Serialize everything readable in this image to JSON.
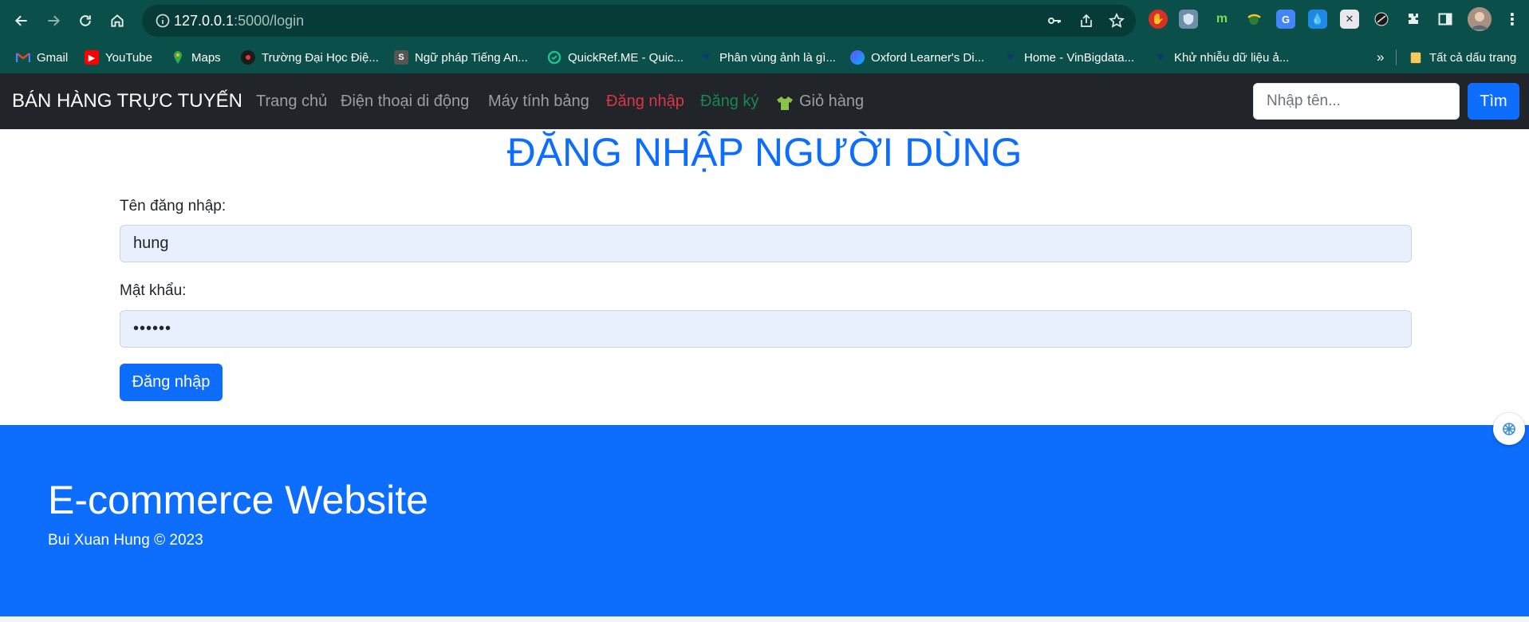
{
  "browser": {
    "url_host": "127.0.0.1",
    "url_path": ":5000/login",
    "bookmarks": [
      {
        "label": "Gmail",
        "icon": "gmail-icon",
        "color": "#ea4335"
      },
      {
        "label": "YouTube",
        "icon": "youtube-icon",
        "color": "#ff0000"
      },
      {
        "label": "Maps",
        "icon": "maps-icon",
        "color": "#34a853"
      },
      {
        "label": "Trường Đại Học Điệ...",
        "icon": "university-icon",
        "color": "#c62828"
      },
      {
        "label": "Ngữ pháp Tiếng An...",
        "icon": "s-icon",
        "color": "#444444"
      },
      {
        "label": "QuickRef.ME - Quic...",
        "icon": "quickref-icon",
        "color": "#1fbf8f"
      },
      {
        "label": "Phân vùng ảnh là gì...",
        "icon": "heart-icon",
        "color": "#0b3b6f"
      },
      {
        "label": "Oxford Learner's Di...",
        "icon": "oxford-icon",
        "color": "#6a4cff"
      },
      {
        "label": "Home - VinBigdata...",
        "icon": "heart-icon",
        "color": "#0b3b6f"
      },
      {
        "label": "Khử nhiễu dữ liệu ả...",
        "icon": "heart-icon",
        "color": "#0b3b6f"
      }
    ],
    "overflow": "»",
    "all_bookmarks": "Tất cả dấu trang"
  },
  "navbar": {
    "brand": "BÁN HÀNG TRỰC TUYẾN",
    "links": [
      "Trang chủ",
      "Điện thoại di động",
      "Máy tính bảng",
      "Đăng nhập",
      "Đăng ký",
      "Giỏ hàng"
    ],
    "search_placeholder": "Nhập tên...",
    "search_button": "Tìm"
  },
  "form": {
    "title": "ĐĂNG NHẬP NGƯỜI DÙNG",
    "username_label": "Tên đăng nhập:",
    "username_value": "hung",
    "password_label": "Mật khẩu:",
    "password_value": "••••••",
    "submit": "Đăng nhập"
  },
  "footer": {
    "title": "E-commerce Website",
    "copyright": "Bui Xuan Hung © 2023"
  },
  "colors": {
    "chrome": "#0b4f4a",
    "navbar": "#212529",
    "primary": "#0d6efd",
    "danger": "#dc3545",
    "success": "#198754"
  }
}
